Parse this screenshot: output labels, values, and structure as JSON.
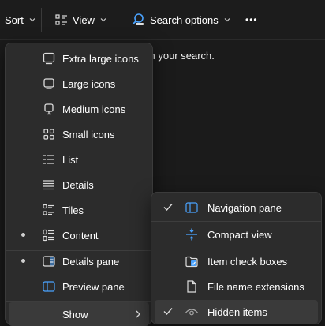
{
  "toolbar": {
    "sort_label": "Sort",
    "view_label": "View",
    "search_options_label": "Search options",
    "more_label": "•••"
  },
  "background": {
    "partial_text": "ch your search."
  },
  "view_menu": {
    "items": [
      {
        "label": "Extra large icons",
        "icon": "monitor-large-icon",
        "selected": false
      },
      {
        "label": "Large icons",
        "icon": "monitor-icon",
        "selected": false
      },
      {
        "label": "Medium icons",
        "icon": "monitor-small-icon",
        "selected": false
      },
      {
        "label": "Small icons",
        "icon": "grid-icon",
        "selected": false
      },
      {
        "label": "List",
        "icon": "list-icon",
        "selected": false
      },
      {
        "label": "Details",
        "icon": "details-icon",
        "selected": false
      },
      {
        "label": "Tiles",
        "icon": "tiles-icon",
        "selected": false
      },
      {
        "label": "Content",
        "icon": "content-icon",
        "selected": true
      },
      {
        "label": "Details pane",
        "icon": "details-pane-icon",
        "selected": true
      },
      {
        "label": "Preview pane",
        "icon": "preview-pane-icon",
        "selected": false
      },
      {
        "label": "Show",
        "icon": "chevron-right-icon",
        "selected": false
      }
    ]
  },
  "show_menu": {
    "items": [
      {
        "label": "Navigation pane",
        "icon": "navigation-pane-icon",
        "checked": true
      },
      {
        "label": "Compact view",
        "icon": "compact-view-icon",
        "checked": false
      },
      {
        "label": "Item check boxes",
        "icon": "item-checkbox-icon",
        "checked": false
      },
      {
        "label": "File name extensions",
        "icon": "file-icon",
        "checked": false
      },
      {
        "label": "Hidden items",
        "icon": "eye-icon",
        "checked": true
      }
    ]
  },
  "colors": {
    "background": "#1b1b1b",
    "menu": "#2c2c2c",
    "highlight": "#3a3a3a",
    "accent": "#4aa3ff"
  }
}
